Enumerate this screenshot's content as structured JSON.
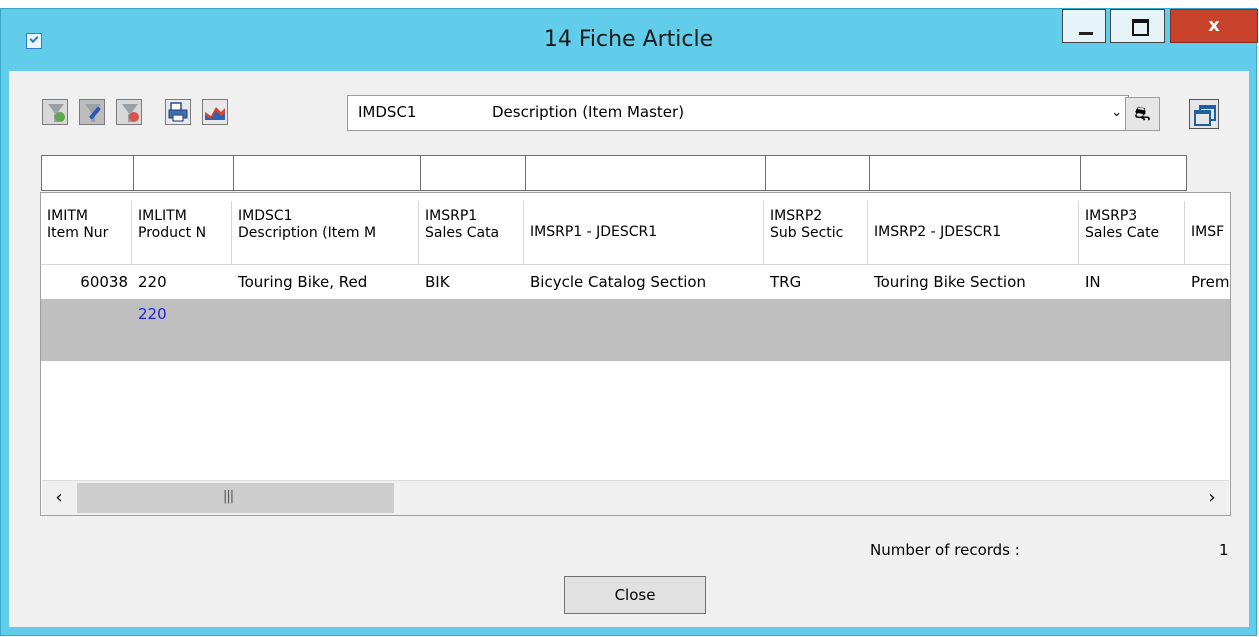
{
  "window": {
    "title": "14 Fiche Article",
    "close_glyph": "x"
  },
  "toolbar": {
    "buttons": [
      {
        "name": "add-filter-button",
        "icon": "filter-add-icon"
      },
      {
        "name": "edit-filter-button",
        "icon": "filter-edit-icon"
      },
      {
        "name": "remove-filter-button",
        "icon": "filter-remove-icon"
      },
      {
        "name": "print-button",
        "icon": "print-icon"
      },
      {
        "name": "chart-button",
        "icon": "chart-icon"
      }
    ],
    "column_select": {
      "code": "IMDSC1",
      "description": "Description (Item Master)"
    }
  },
  "grid": {
    "headers": [
      {
        "line1": "IMITM",
        "line2": "Item Nur"
      },
      {
        "line1": "IMLITM",
        "line2": "Product N"
      },
      {
        "line1": "IMDSC1",
        "line2": "Description (Item M"
      },
      {
        "line1": "IMSRP1",
        "line2": "Sales Cata"
      },
      {
        "line1": "IMSRP1 - JDESCR1",
        "line2": ""
      },
      {
        "line1": "IMSRP2",
        "line2": "Sub Sectic"
      },
      {
        "line1": "IMSRP2 - JDESCR1",
        "line2": ""
      },
      {
        "line1": "IMSRP3",
        "line2": "Sales Cate"
      },
      {
        "line1": "IMSF",
        "line2": ""
      }
    ],
    "rows": [
      [
        "60038",
        "220",
        "Touring Bike, Red",
        "BIK",
        "Bicycle Catalog Section",
        "TRG",
        "Touring Bike Section",
        "IN",
        "Prem"
      ],
      [
        "",
        "220",
        "",
        "",
        "",
        "",
        "",
        "",
        ""
      ]
    ]
  },
  "footer": {
    "records_label": "Number of records :",
    "records_count": "1",
    "close_label": "Close"
  },
  "colors": {
    "titlebar": "#62cdea",
    "selected_row": "#bfbfbf",
    "selected_text": "#1d22e0",
    "close_control": "#c8412a"
  }
}
